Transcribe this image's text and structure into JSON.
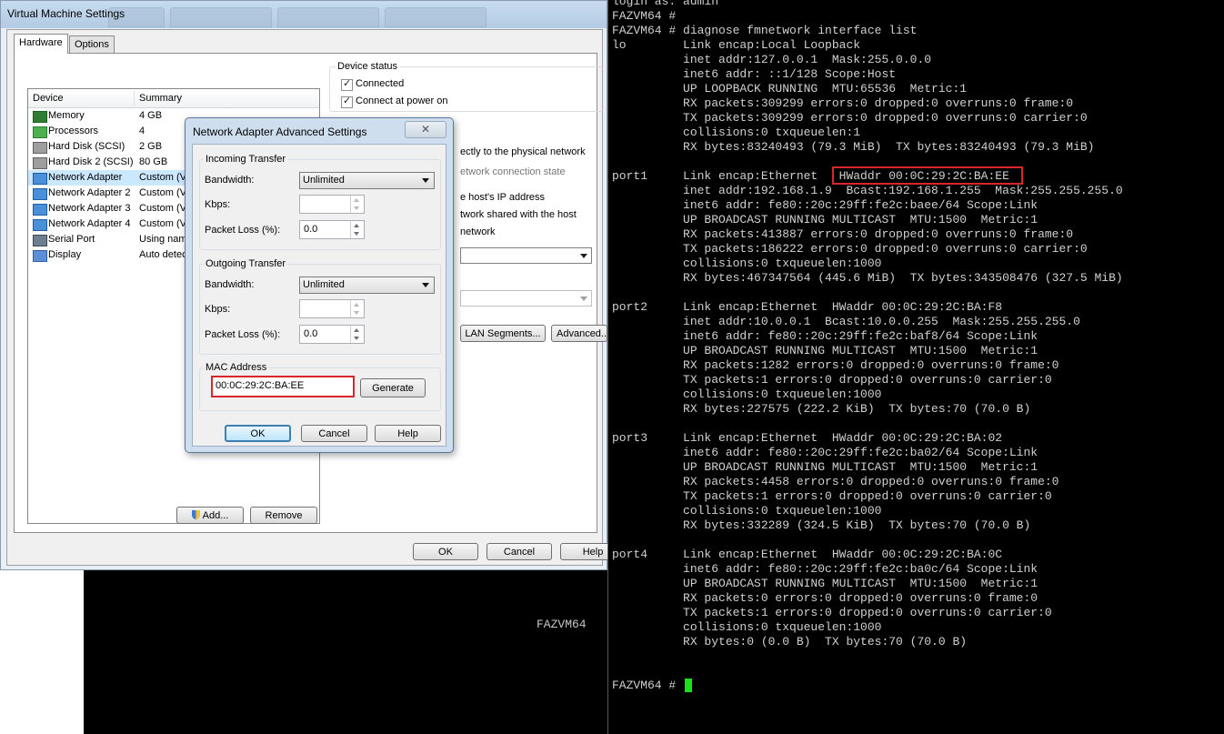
{
  "vm_settings": {
    "title": "Virtual Machine Settings",
    "tabs": [
      {
        "label": "Hardware"
      },
      {
        "label": "Options"
      }
    ],
    "device_list": {
      "headers": {
        "device": "Device",
        "summary": "Summary"
      },
      "rows": [
        {
          "device": "Memory",
          "summary": "4 GB",
          "icon": "memory-icon"
        },
        {
          "device": "Processors",
          "summary": "4",
          "icon": "processor-icon"
        },
        {
          "device": "Hard Disk (SCSI)",
          "summary": "2 GB",
          "icon": "hard-disk-icon"
        },
        {
          "device": "Hard Disk 2 (SCSI)",
          "summary": "80 GB",
          "icon": "hard-disk-icon"
        },
        {
          "device": "Network Adapter",
          "summary": "Custom (VMnet",
          "icon": "network-adapter-icon"
        },
        {
          "device": "Network Adapter 2",
          "summary": "Custom (VMnet",
          "icon": "network-adapter-icon"
        },
        {
          "device": "Network Adapter 3",
          "summary": "Custom (VMnet",
          "icon": "network-adapter-icon"
        },
        {
          "device": "Network Adapter 4",
          "summary": "Custom (VMnet",
          "icon": "network-adapter-icon"
        },
        {
          "device": "Serial Port",
          "summary": "Using named pipe",
          "icon": "serial-port-icon"
        },
        {
          "device": "Display",
          "summary": "Auto detect",
          "icon": "display-icon"
        }
      ],
      "selected_index": 4
    },
    "add_button": "Add...",
    "remove_button": "Remove",
    "device_status": {
      "label": "Device status",
      "connected": "Connected",
      "connect_at_power_on": "Connect at power on"
    },
    "partial_text": {
      "connect_physical": "ectly to the physical network",
      "replicate_state": "etwork connection state",
      "host_ip": "e host's IP address",
      "shared": "twork shared with the host",
      "network": "network"
    },
    "lan_segments_button": "LAN Segments...",
    "advanced_button": "Advanced...",
    "ok_button": "OK",
    "cancel_button": "Cancel",
    "help_button": "Help"
  },
  "adapter_dialog": {
    "title": "Network Adapter Advanced Settings",
    "incoming": {
      "legend": "Incoming Transfer",
      "bandwidth_label": "Bandwidth:",
      "bandwidth_value": "Unlimited",
      "kbps_label": "Kbps:",
      "kbps_value": "",
      "packet_loss_label": "Packet Loss (%):",
      "packet_loss_value": "0.0"
    },
    "outgoing": {
      "legend": "Outgoing Transfer",
      "bandwidth_label": "Bandwidth:",
      "bandwidth_value": "Unlimited",
      "kbps_label": "Kbps:",
      "kbps_value": "",
      "packet_loss_label": "Packet Loss (%):",
      "packet_loss_value": "0.0"
    },
    "mac": {
      "legend": "MAC Address",
      "value": "00:0C:29:2C:BA:EE",
      "generate_button": "Generate"
    },
    "ok_button": "OK",
    "cancel_button": "Cancel",
    "help_button": "Help",
    "close_symbol": "✕"
  },
  "background_console": {
    "hostname": "FAZVM64"
  },
  "terminal": {
    "lines": [
      "login as: admin",
      "FAZVM64 #",
      "FAZVM64 # diagnose fmnetwork interface list",
      "lo        Link encap:Local Loopback",
      "          inet addr:127.0.0.1  Mask:255.0.0.0",
      "          inet6 addr: ::1/128 Scope:Host",
      "          UP LOOPBACK RUNNING  MTU:65536  Metric:1",
      "          RX packets:309299 errors:0 dropped:0 overruns:0 frame:0",
      "          TX packets:309299 errors:0 dropped:0 overruns:0 carrier:0",
      "          collisions:0 txqueuelen:1",
      "          RX bytes:83240493 (79.3 MiB)  TX bytes:83240493 (79.3 MiB)",
      "",
      "port1     Link encap:Ethernet   HWaddr 00:0C:29:2C:BA:EE",
      "          inet addr:192.168.1.9  Bcast:192.168.1.255  Mask:255.255.255.0",
      "          inet6 addr: fe80::20c:29ff:fe2c:baee/64 Scope:Link",
      "          UP BROADCAST RUNNING MULTICAST  MTU:1500  Metric:1",
      "          RX packets:413887 errors:0 dropped:0 overruns:0 frame:0",
      "          TX packets:186222 errors:0 dropped:0 overruns:0 carrier:0",
      "          collisions:0 txqueuelen:1000",
      "          RX bytes:467347564 (445.6 MiB)  TX bytes:343508476 (327.5 MiB)",
      "",
      "port2     Link encap:Ethernet  HWaddr 00:0C:29:2C:BA:F8",
      "          inet addr:10.0.0.1  Bcast:10.0.0.255  Mask:255.255.255.0",
      "          inet6 addr: fe80::20c:29ff:fe2c:baf8/64 Scope:Link",
      "          UP BROADCAST RUNNING MULTICAST  MTU:1500  Metric:1",
      "          RX packets:1282 errors:0 dropped:0 overruns:0 frame:0",
      "          TX packets:1 errors:0 dropped:0 overruns:0 carrier:0",
      "          collisions:0 txqueuelen:1000",
      "          RX bytes:227575 (222.2 KiB)  TX bytes:70 (70.0 B)",
      "",
      "port3     Link encap:Ethernet  HWaddr 00:0C:29:2C:BA:02",
      "          inet6 addr: fe80::20c:29ff:fe2c:ba02/64 Scope:Link",
      "          UP BROADCAST RUNNING MULTICAST  MTU:1500  Metric:1",
      "          RX packets:4458 errors:0 dropped:0 overruns:0 frame:0",
      "          TX packets:1 errors:0 dropped:0 overruns:0 carrier:0",
      "          collisions:0 txqueuelen:1000",
      "          RX bytes:332289 (324.5 KiB)  TX bytes:70 (70.0 B)",
      "",
      "port4     Link encap:Ethernet  HWaddr 00:0C:29:2C:BA:0C",
      "          inet6 addr: fe80::20c:29ff:fe2c:ba0c/64 Scope:Link",
      "          UP BROADCAST RUNNING MULTICAST  MTU:1500  Metric:1",
      "          RX packets:0 errors:0 dropped:0 overruns:0 frame:0",
      "          TX packets:1 errors:0 dropped:0 overruns:0 carrier:0",
      "          collisions:0 txqueuelen:1000",
      "          RX bytes:0 (0.0 B)  TX bytes:70 (70.0 B)",
      "",
      "",
      "FAZVM64 # "
    ]
  },
  "colors": {
    "highlight": "#d8262b",
    "cursor": "#18e018",
    "selection": "#cce8ff"
  }
}
